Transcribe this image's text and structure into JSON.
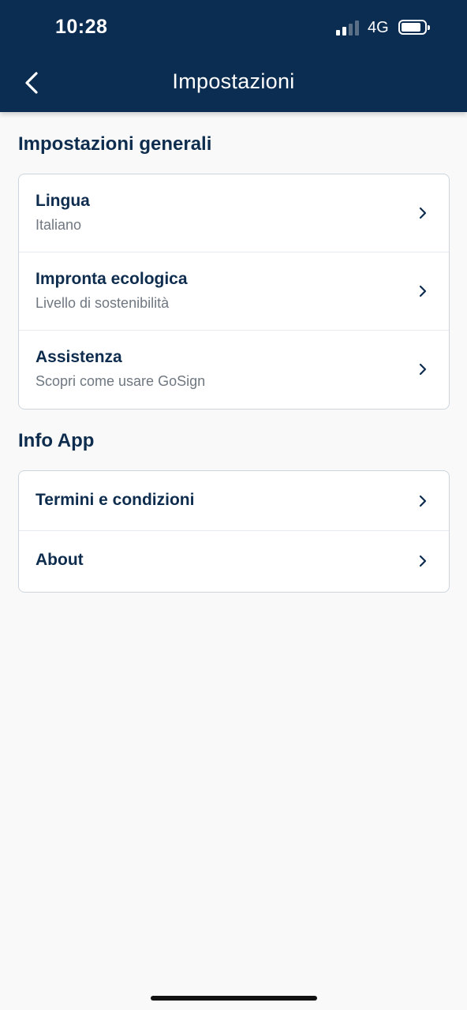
{
  "status_bar": {
    "time": "10:28",
    "network": "4G",
    "signal_bars_filled": 2,
    "signal_bars_total": 4,
    "battery_level": 0.85
  },
  "header": {
    "title": "Impostazioni",
    "back_icon": "chevron-left-icon"
  },
  "sections": {
    "general": {
      "title": "Impostazioni generali",
      "items": [
        {
          "title": "Lingua",
          "subtitle": "Italiano"
        },
        {
          "title": "Impronta ecologica",
          "subtitle": "Livello di sostenibilità"
        },
        {
          "title": "Assistenza",
          "subtitle": "Scopri come usare GoSign"
        }
      ]
    },
    "info": {
      "title": "Info App",
      "items": [
        {
          "title": "Termini e condizioni"
        },
        {
          "title": "About"
        }
      ]
    }
  },
  "colors": {
    "header_bg": "#0c2d52",
    "text_primary": "#0e2d4e",
    "text_secondary": "#6f7780",
    "page_bg": "#f9f9f9"
  }
}
